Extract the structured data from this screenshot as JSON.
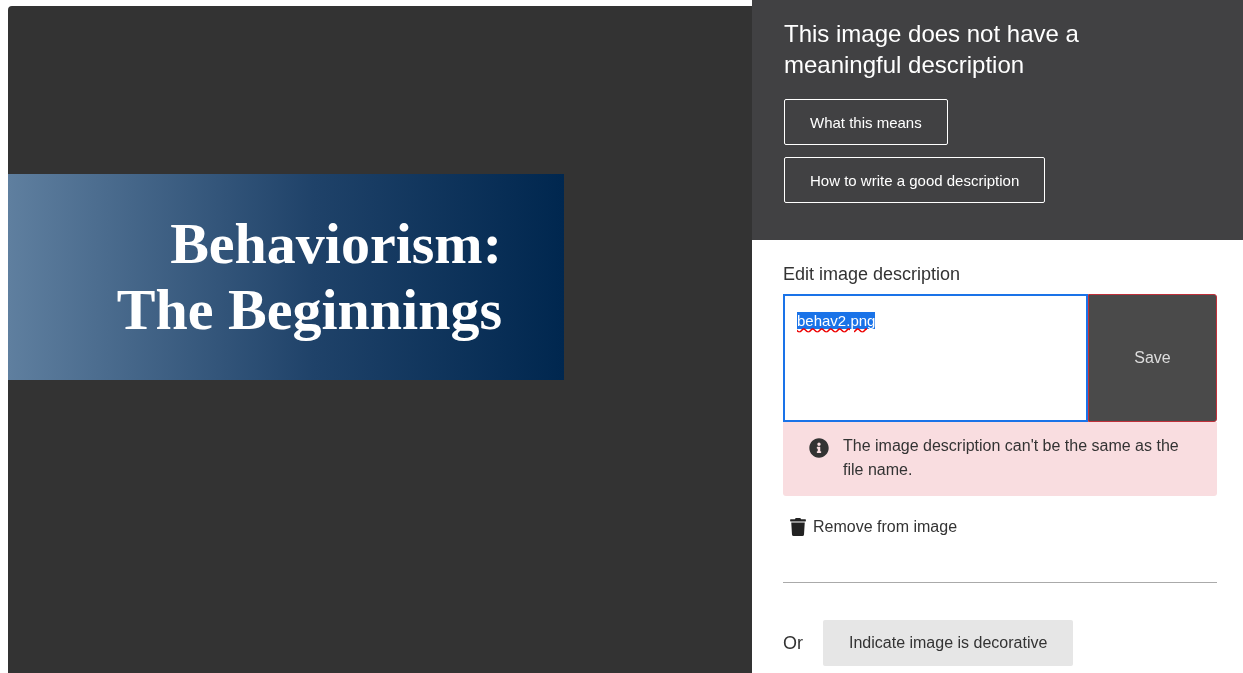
{
  "slide": {
    "title_lines": [
      "Behaviorism:",
      "The Beginnings"
    ]
  },
  "panel": {
    "heading": "This image does not have a meaningful description",
    "help_buttons": [
      "What this means",
      "How to write a good description"
    ],
    "edit_label": "Edit image description",
    "description_field": {
      "value": "behav2.png",
      "selected": true
    },
    "save_button": "Save",
    "error": "The image description can't be the same as the file name.",
    "remove_link": "Remove from image",
    "or_label": "Or",
    "decorative_button": "Indicate image is decorative"
  }
}
